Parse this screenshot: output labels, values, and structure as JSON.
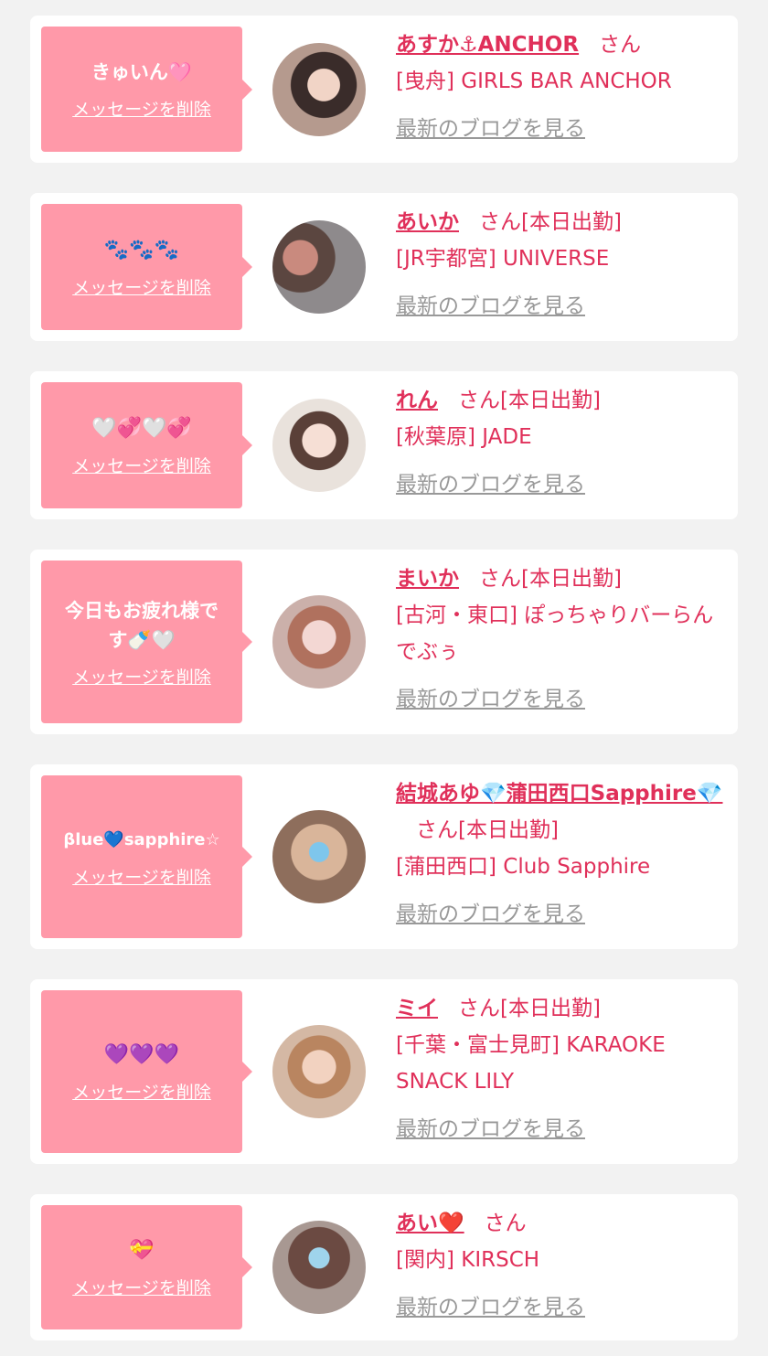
{
  "colors": {
    "bubble": "#ff99a9",
    "accent": "#e0305a",
    "link_gray": "#999999",
    "bg": "#f2f2f2"
  },
  "delete_label": "メッセージを削除",
  "blog_label": "最新のブログを見る",
  "san": "さん",
  "cards": [
    {
      "message": "きゅいん🩷",
      "name": "あすか⚓ANCHOR",
      "suffix": "",
      "shop": "[曳舟] GIRLS BAR ANCHOR"
    },
    {
      "message": "🐾🐾🐾",
      "name": "あいか",
      "suffix": "[本日出勤]",
      "shop": "[JR宇都宮] UNIVERSE"
    },
    {
      "message": "🤍💞🤍💞",
      "name": "れん",
      "suffix": "[本日出勤]",
      "shop": "[秋葉原] JADE"
    },
    {
      "message": "今日もお疲れ様で\nす🍼🤍",
      "name": "まいか",
      "suffix": "[本日出勤]",
      "shop": "[古河・東口] ぽっちゃりバーらんでぶぅ"
    },
    {
      "message": "βlue💙sapphire☆",
      "name": "結城あゆ💎蒲田西口Sapphire💎",
      "suffix": "[本日出勤]",
      "shop": "[蒲田西口] Club Sapphire"
    },
    {
      "message": "💜💜💜",
      "name": "ミイ",
      "suffix": "[本日出勤]",
      "shop": "[千葉・富士見町] KARAOKE SNACK LILY"
    },
    {
      "message": "💝",
      "name": "あい❤️",
      "suffix": "",
      "shop": "[関内] KIRSCH"
    }
  ]
}
